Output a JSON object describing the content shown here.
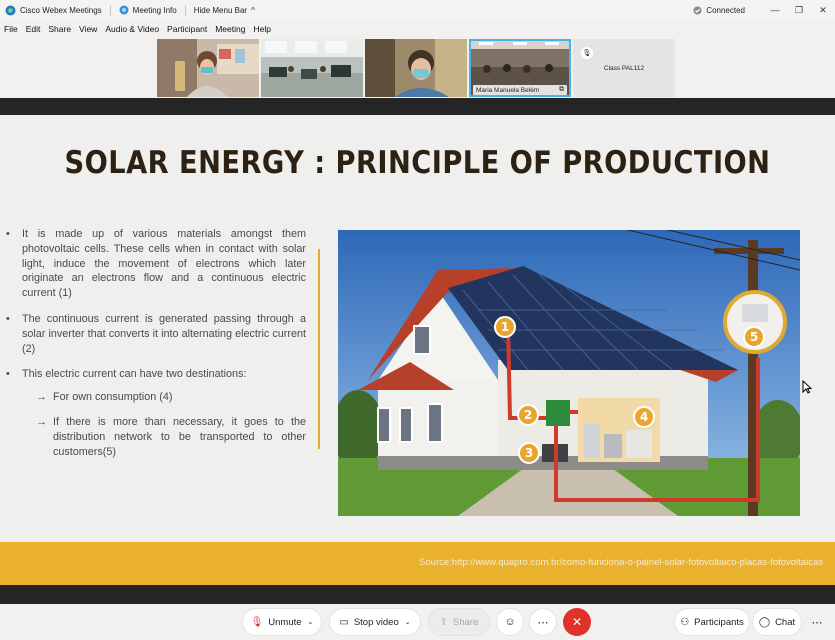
{
  "titlebar": {
    "app_name": "Cisco Webex Meetings",
    "meeting_info": "Meeting Info",
    "hide_menu": "Hide Menu Bar",
    "status": "Connected",
    "status_color": "#8a8a8a"
  },
  "menu": [
    "File",
    "Edit",
    "Share",
    "View",
    "Audio & Video",
    "Participant",
    "Meeting",
    "Help"
  ],
  "videos": {
    "active_name": "Maria Manuela Belém",
    "class_tile": "Class PAL112"
  },
  "slide": {
    "title": "SOLAR ENERGY : PRINCIPLE OF PRODUCTION",
    "bullets": [
      "It is made up of various materials amongst them photovoltaic cells. These cells when in contact with solar light, induce the movement of electrons which later originate an electrons flow and a continuous electric current (1)",
      "The continuous current is generated passing through a solar inverter that converts it into alternating electric current (2)",
      "This electric current can have two destinations:"
    ],
    "sub_bullets": [
      "For own consumption (4)",
      "If there is more than necessary, it goes to the distribution network to be transported to other customers(5)"
    ],
    "markers": [
      "1",
      "2",
      "3",
      "4",
      "5"
    ],
    "source": "Source:http://www.quapro.com.br/como-funciona-o-painel-solar-fotovoltaico-placas-fotovoltaicas",
    "accent_color": "#e9b12e",
    "title_color": "#2d2113"
  },
  "controls": {
    "unmute": "Unmute",
    "stop_video": "Stop video",
    "share": "Share",
    "participants": "Participants",
    "chat": "Chat"
  }
}
